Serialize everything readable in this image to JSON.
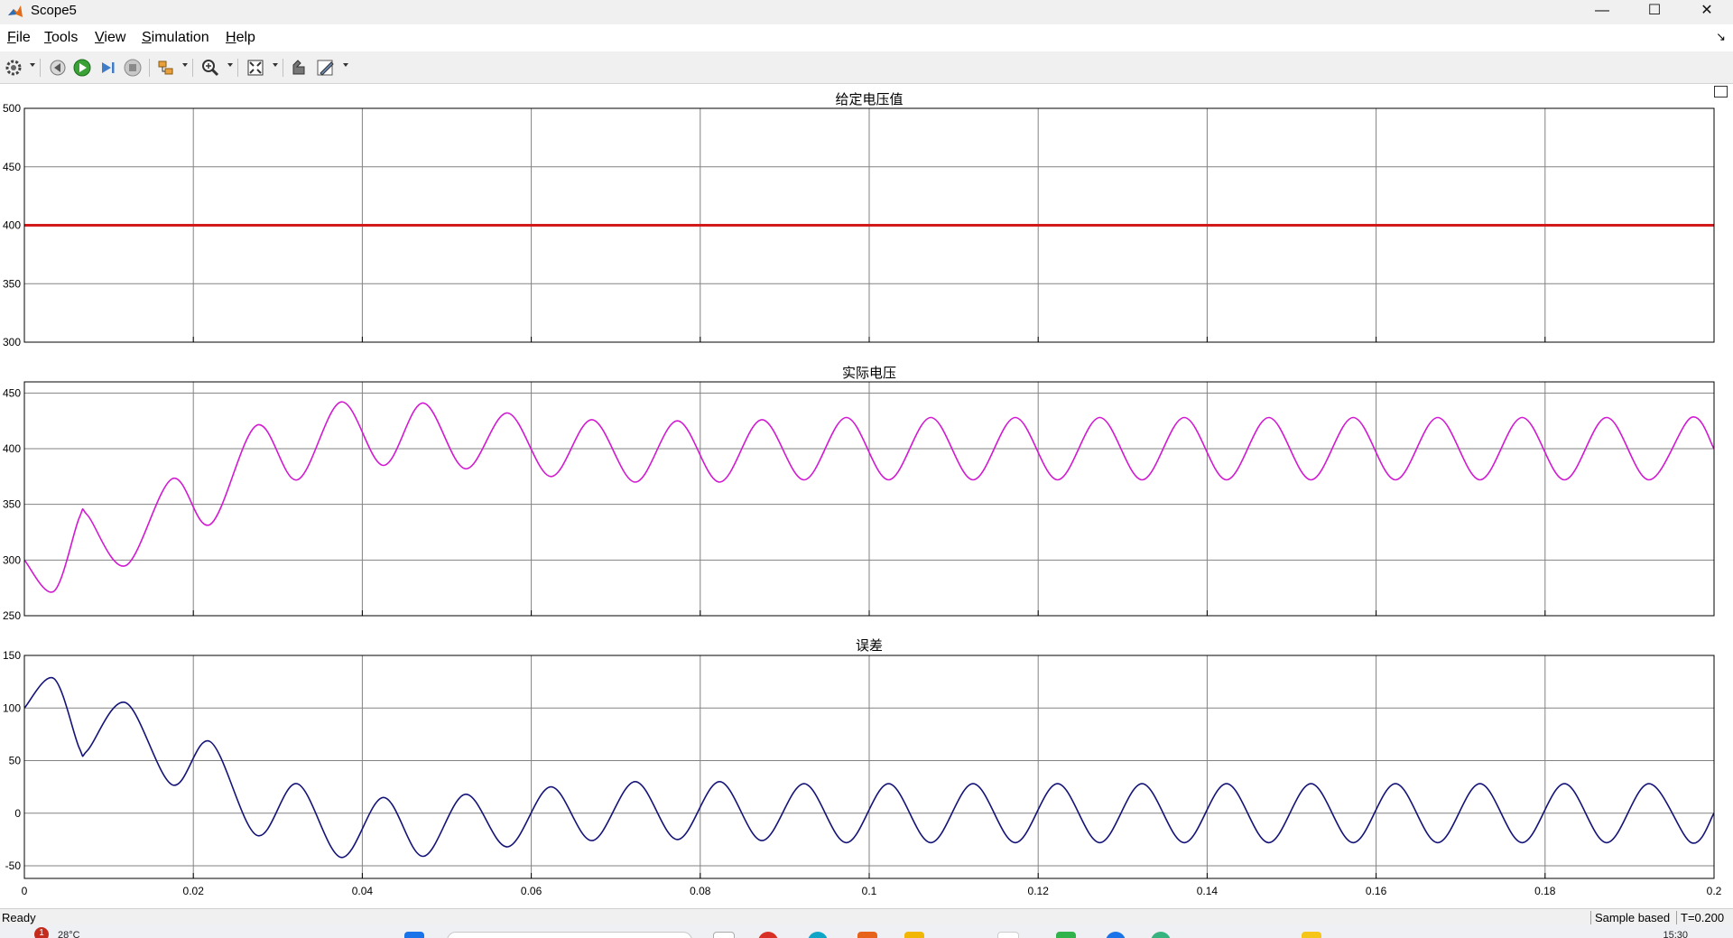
{
  "window": {
    "title": "Scope5",
    "minimize_glyph": "—",
    "maximize_glyph": "☐",
    "close_glyph": "✕"
  },
  "menu": {
    "items": [
      {
        "acc": "F",
        "rest": "ile"
      },
      {
        "acc": "T",
        "rest": "ools"
      },
      {
        "acc": "V",
        "rest": "iew"
      },
      {
        "acc": "S",
        "rest": "imulation"
      },
      {
        "acc": "H",
        "rest": "elp"
      }
    ],
    "overflow_glyph": "↘"
  },
  "toolbar": {
    "icons": [
      "gear-icon",
      "step-back-icon",
      "run-icon",
      "step-forward-icon",
      "stop-icon",
      "highlight-icon",
      "zoom-icon",
      "autoscale-icon",
      "legend-icon",
      "edit-icon"
    ]
  },
  "colors": {
    "series1": "#d21a1a",
    "series2": "#d21ad2",
    "series3": "#141478",
    "grid": "#828282",
    "axes": "#000000"
  },
  "chart_data": [
    {
      "type": "line",
      "title": "给定电压值",
      "xlim": [
        0,
        0.2
      ],
      "ylim": [
        300,
        500
      ],
      "yticks": [
        300,
        350,
        400,
        450,
        500
      ],
      "xtick_labels": [],
      "grid": true,
      "series": [
        {
          "color": "#d21a1a",
          "x": [
            0,
            0.05,
            0.1,
            0.15,
            0.2
          ],
          "values": [
            400,
            400,
            400,
            400,
            400
          ]
        }
      ]
    },
    {
      "type": "line",
      "title": "实际电压",
      "xlim": [
        0,
        0.2
      ],
      "ylim": [
        250,
        460
      ],
      "yticks": [
        250,
        300,
        350,
        400,
        450
      ],
      "xtick_labels": [],
      "grid": true,
      "series": [
        {
          "color": "#d21ad2",
          "x": [
            0,
            0.0035,
            0.0065,
            0.0075,
            0.012,
            0.0175,
            0.022,
            0.0275,
            0.0323,
            0.0375,
            0.0425,
            0.0472,
            0.0522,
            0.0572,
            0.0623,
            0.0672,
            0.0723,
            0.0773,
            0.0823,
            0.0873,
            0.0923,
            0.0973,
            0.1023,
            0.1073,
            0.1123,
            0.1173,
            0.1223,
            0.1273,
            0.1323,
            0.1373,
            0.1423,
            0.1473,
            0.1523,
            0.1573,
            0.1623,
            0.1673,
            0.1723,
            0.1773,
            0.1823,
            0.1873,
            0.1923,
            0.1973,
            0.2
          ],
          "values": [
            300,
            272,
            338,
            340,
            295,
            373,
            332,
            421,
            372,
            442,
            385,
            441,
            382,
            432,
            375,
            426,
            370,
            425,
            370,
            426,
            372,
            428,
            372,
            428,
            372,
            428,
            372,
            428,
            372,
            428,
            372,
            428,
            372,
            428,
            372,
            428,
            372,
            428,
            372,
            428,
            372,
            428,
            400
          ]
        }
      ]
    },
    {
      "type": "line",
      "title": "误差",
      "xlim": [
        0,
        0.2
      ],
      "ylim": [
        -62,
        150
      ],
      "yticks": [
        -50,
        0,
        50,
        100,
        150
      ],
      "xtick_labels": [
        "0",
        "0.02",
        "0.04",
        "0.06",
        "0.08",
        "0.1",
        "0.12",
        "0.14",
        "0.16",
        "0.18",
        "0.2"
      ],
      "grid": true,
      "series": [
        {
          "color": "#141478",
          "x": [
            0,
            0.0035,
            0.0065,
            0.0075,
            0.012,
            0.0175,
            0.022,
            0.0275,
            0.0323,
            0.0375,
            0.0425,
            0.0472,
            0.0522,
            0.0572,
            0.0623,
            0.0672,
            0.0723,
            0.0773,
            0.0823,
            0.0873,
            0.0923,
            0.0973,
            0.1023,
            0.1073,
            0.1123,
            0.1173,
            0.1223,
            0.1273,
            0.1323,
            0.1373,
            0.1423,
            0.1473,
            0.1523,
            0.1573,
            0.1623,
            0.1673,
            0.1723,
            0.1773,
            0.1823,
            0.1873,
            0.1923,
            0.1973,
            0.2
          ],
          "values": [
            100,
            128,
            62,
            60,
            105,
            27,
            68,
            -21,
            28,
            -42,
            15,
            -41,
            18,
            -32,
            25,
            -26,
            30,
            -25,
            30,
            -26,
            28,
            -28,
            28,
            -28,
            28,
            -28,
            28,
            -28,
            28,
            -28,
            28,
            -28,
            28,
            -28,
            28,
            -28,
            28,
            -28,
            28,
            -28,
            28,
            -28,
            0
          ]
        }
      ]
    }
  ],
  "status": {
    "text": "Ready",
    "cells": [
      "Sample based",
      "T=0.200"
    ]
  },
  "taskbar": {
    "badge": "1",
    "weather": "28°C",
    "clock": "15:30"
  }
}
